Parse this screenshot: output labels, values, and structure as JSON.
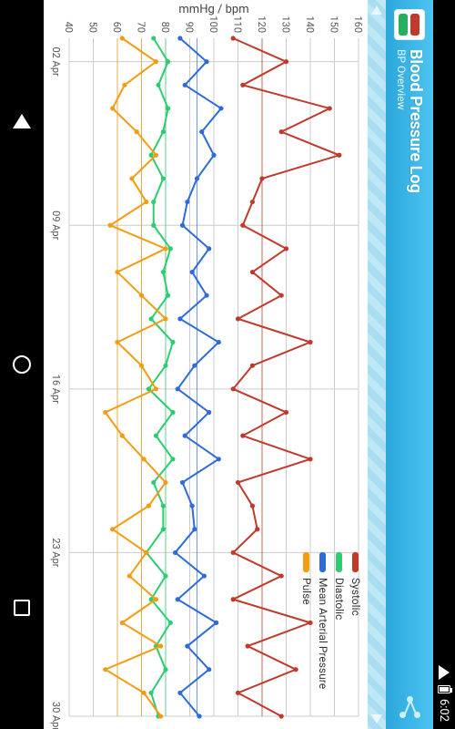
{
  "status": {
    "time": "6:02"
  },
  "header": {
    "title": "Blood Pressure Log",
    "subtitle": "BP Overview"
  },
  "chart_data": {
    "type": "line",
    "ylabel": "mmHg / bpm",
    "ylim": [
      40,
      160
    ],
    "yticks": [
      40,
      50,
      60,
      70,
      80,
      90,
      100,
      110,
      120,
      130,
      140,
      150,
      160
    ],
    "xticks": [
      "02 Apr",
      "09 Apr",
      "16 Apr",
      "23 Apr",
      "30 Apr"
    ],
    "x": [
      1,
      2,
      3,
      4,
      5,
      6,
      7,
      8,
      9,
      10,
      11,
      12,
      13,
      14,
      15,
      16,
      17,
      18,
      19,
      20,
      21,
      22,
      23,
      24,
      25,
      26,
      27,
      28,
      29,
      30
    ],
    "legend": [
      "Systolic",
      "Diastolic",
      "Mean Arterial Pressure",
      "Pulse"
    ],
    "colors": {
      "Systolic": "#c0392b",
      "Diastolic": "#2ecc71",
      "Mean Arterial Pressure": "#2e6bd8",
      "Pulse": "#f39c12"
    },
    "refs": {
      "Systolic": 120,
      "Diastolic": 80,
      "Mean Arterial Pressure": 93,
      "Pulse_low": 60,
      "Pulse_high": 70
    },
    "series": [
      {
        "name": "Systolic",
        "values": [
          108,
          130,
          112,
          148,
          128,
          152,
          120,
          116,
          112,
          130,
          116,
          128,
          110,
          140,
          116,
          108,
          130,
          112,
          140,
          110,
          116,
          118,
          108,
          128,
          108,
          140,
          114,
          134,
          110,
          128
        ]
      },
      {
        "name": "Mean Arterial Pressure",
        "values": [
          86,
          97,
          88,
          103,
          95,
          100,
          93,
          89,
          87,
          98,
          91,
          97,
          86,
          102,
          92,
          85,
          98,
          88,
          102,
          87,
          91,
          92,
          84,
          96,
          85,
          101,
          89,
          98,
          86,
          94
        ]
      },
      {
        "name": "Diastolic",
        "values": [
          75,
          81,
          77,
          81,
          79,
          74,
          79,
          75,
          75,
          82,
          79,
          81,
          74,
          83,
          80,
          73,
          83,
          76,
          83,
          75,
          79,
          79,
          72,
          80,
          74,
          82,
          76,
          80,
          74,
          77
        ]
      },
      {
        "name": "Pulse",
        "values": [
          62,
          76,
          63,
          58,
          68,
          76,
          66,
          72,
          57,
          80,
          60,
          70,
          80,
          60,
          70,
          76,
          55,
          62,
          71,
          80,
          73,
          58,
          72,
          65,
          76,
          62,
          78,
          55,
          71,
          78
        ]
      }
    ]
  }
}
